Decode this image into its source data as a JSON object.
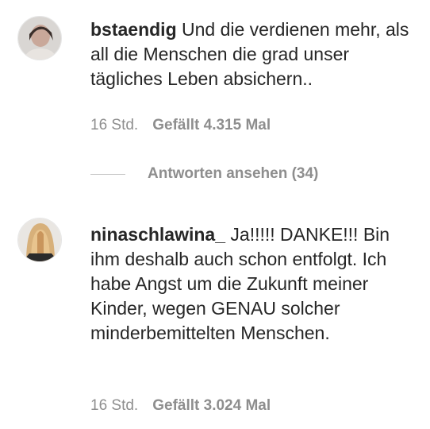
{
  "comments": [
    {
      "username": "bstaendig",
      "text": " Und die verdienen mehr, als all die Menschen die grad unser tägliches Leben absichern..",
      "time": "16 Std.",
      "likes": "Gefällt 4.315 Mal"
    },
    {
      "username": "ninaschlawina_",
      "text": " Ja!!!!! DANKE!!! Bin ihm deshalb auch schon entfolgt. Ich habe Angst um die Zukunft meiner Kinder, wegen GENAU solcher minderbemittelten Menschen.",
      "time": "16 Std.",
      "likes": "Gefällt 3.024 Mal"
    }
  ],
  "replies_link": "Antworten ansehen (34)"
}
